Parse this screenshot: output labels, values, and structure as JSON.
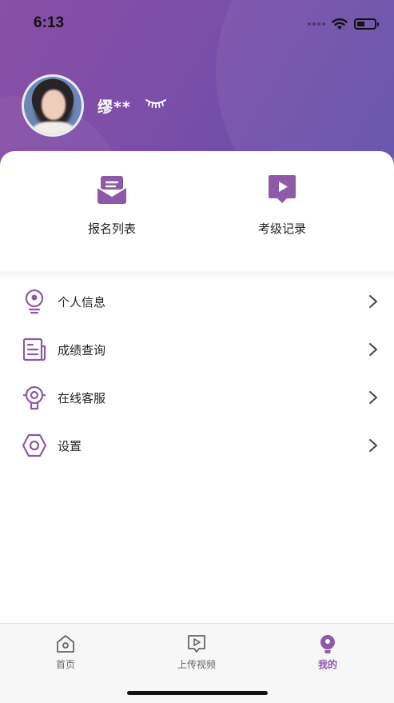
{
  "status_bar": {
    "time": "6:13",
    "battery_level": 0.45
  },
  "profile": {
    "username": "缪**",
    "visibility_icon": "eye-closed-icon"
  },
  "quick_actions": [
    {
      "label": "报名列表",
      "icon": "envelope-list-icon"
    },
    {
      "label": "考级记录",
      "icon": "video-record-icon"
    }
  ],
  "menu": [
    {
      "label": "个人信息",
      "icon": "person-info-icon"
    },
    {
      "label": "成绩查询",
      "icon": "document-score-icon"
    },
    {
      "label": "在线客服",
      "icon": "customer-service-icon"
    },
    {
      "label": "设置",
      "icon": "settings-icon"
    }
  ],
  "tabbar": [
    {
      "label": "首页",
      "icon": "home-icon",
      "active": false
    },
    {
      "label": "上传视频",
      "icon": "upload-video-icon",
      "active": false
    },
    {
      "label": "我的",
      "icon": "profile-icon",
      "active": true
    }
  ],
  "colors": {
    "accent": "#8e59a7",
    "header_start": "#8a4fa6",
    "header_end": "#5f4ea8"
  }
}
